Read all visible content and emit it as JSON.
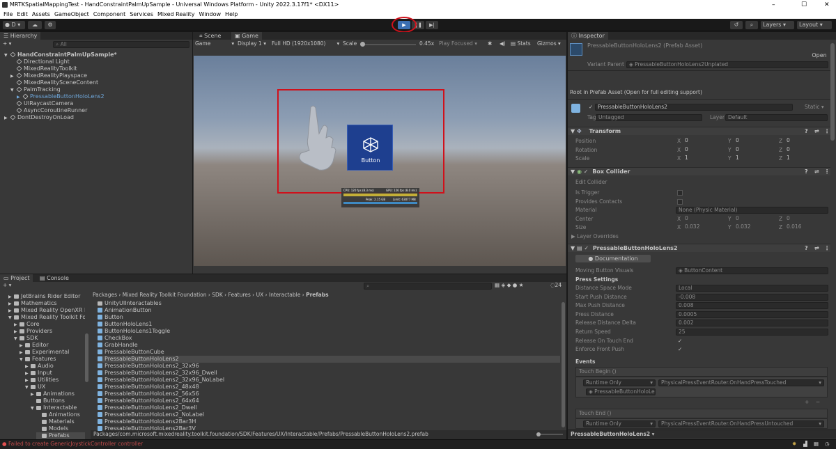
{
  "window": {
    "title": "MRTKSpatialMappingTest - HandConstraintPalmUpSample - Universal Windows Platform - Unity 2022.3.17f1* <DX11>",
    "minimize": "–",
    "maximize": "☐",
    "close": "✕"
  },
  "menu": [
    "File",
    "Edit",
    "Assets",
    "GameObject",
    "Component",
    "Services",
    "Mixed Reality",
    "Window",
    "Help"
  ],
  "toolbar": {
    "account": "D",
    "layers": "Layers",
    "layout": "Layout"
  },
  "hierarchy": {
    "tab": "Hierarchy",
    "search_placeholder": "All",
    "items": [
      {
        "label": "HandConstraintPalmUpSample*",
        "depth": 0,
        "bold": true,
        "arrow": "▼"
      },
      {
        "label": "Directional Light",
        "depth": 1,
        "arrow": ""
      },
      {
        "label": "MixedRealityToolkit",
        "depth": 1,
        "arrow": ""
      },
      {
        "label": "MixedRealityPlayspace",
        "depth": 1,
        "arrow": "▶"
      },
      {
        "label": "MixedRealitySceneContent",
        "depth": 1,
        "arrow": ""
      },
      {
        "label": "PalmTracking",
        "depth": 1,
        "arrow": "▼"
      },
      {
        "label": "PressableButtonHoloLens2",
        "depth": 2,
        "arrow": "▶",
        "blue": true
      },
      {
        "label": "UIRaycastCamera",
        "depth": 1,
        "arrow": ""
      },
      {
        "label": "AsyncCoroutineRunner",
        "depth": 1,
        "arrow": ""
      },
      {
        "label": "DontDestroyOnLoad",
        "depth": 0,
        "arrow": "▶"
      }
    ]
  },
  "game": {
    "tabs": [
      "Scene",
      "Game"
    ],
    "display_mode": "Game",
    "display": "Display 1",
    "resolution": "Full HD (1920x1080)",
    "scale_label": "Scale",
    "scale_value": "0.45x",
    "play_focused": "Play Focused",
    "stats": "Stats",
    "gizmos": "Gizmos",
    "button_label": "Button",
    "hud_cpu": "CPU: 120 fps (8.3 ms)",
    "hud_gpu": "GPU: 126 fps (8.0 ms)",
    "hud_mem": "Peak: 2.15 GB",
    "hud_limit": "Limit: 63077 MB"
  },
  "project": {
    "tabs": [
      "Project",
      "Console"
    ],
    "breadcrumb": [
      "Packages",
      "Mixed Reality Toolkit Foundation",
      "SDK",
      "Features",
      "UX",
      "Interactable",
      "Prefabs"
    ],
    "count": "24",
    "tree": [
      {
        "label": "JetBrains Rider Editor",
        "depth": 1,
        "arrow": "▶"
      },
      {
        "label": "Mathematics",
        "depth": 1,
        "arrow": "▶"
      },
      {
        "label": "Mixed Reality OpenXR Plu",
        "depth": 1,
        "arrow": "▶"
      },
      {
        "label": "Mixed Reality Toolkit Four",
        "depth": 1,
        "arrow": "▼"
      },
      {
        "label": "Core",
        "depth": 2,
        "arrow": "▶"
      },
      {
        "label": "Providers",
        "depth": 2,
        "arrow": "▶"
      },
      {
        "label": "SDK",
        "depth": 2,
        "arrow": "▼"
      },
      {
        "label": "Editor",
        "depth": 3,
        "arrow": "▶"
      },
      {
        "label": "Experimental",
        "depth": 3,
        "arrow": "▶"
      },
      {
        "label": "Features",
        "depth": 3,
        "arrow": "▼"
      },
      {
        "label": "Audio",
        "depth": 4,
        "arrow": "▶"
      },
      {
        "label": "Input",
        "depth": 4,
        "arrow": "▶"
      },
      {
        "label": "Utilities",
        "depth": 4,
        "arrow": "▶"
      },
      {
        "label": "UX",
        "depth": 4,
        "arrow": "▼"
      },
      {
        "label": "Animations",
        "depth": 5,
        "arrow": "▶"
      },
      {
        "label": "Buttons",
        "depth": 5,
        "arrow": ""
      },
      {
        "label": "Interactable",
        "depth": 5,
        "arrow": "▼"
      },
      {
        "label": "Animations",
        "depth": 6,
        "arrow": ""
      },
      {
        "label": "Materials",
        "depth": 6,
        "arrow": ""
      },
      {
        "label": "Models",
        "depth": 6,
        "arrow": ""
      },
      {
        "label": "Prefabs",
        "depth": 6,
        "arrow": "",
        "sel": true
      }
    ],
    "files": [
      {
        "label": "UnityUIInteractables",
        "type": "folder"
      },
      {
        "label": "AnimationButton",
        "type": "prefab"
      },
      {
        "label": "Button",
        "type": "prefab"
      },
      {
        "label": "ButtonHoloLens1",
        "type": "prefab"
      },
      {
        "label": "ButtonHoloLens1Toggle",
        "type": "prefab"
      },
      {
        "label": "CheckBox",
        "type": "prefab"
      },
      {
        "label": "GrabHandle",
        "type": "prefab"
      },
      {
        "label": "PressableButtonCube",
        "type": "prefab"
      },
      {
        "label": "PressableButtonHoloLens2",
        "type": "prefab",
        "sel": true
      },
      {
        "label": "PressableButtonHoloLens2_32x96",
        "type": "prefab"
      },
      {
        "label": "PressableButtonHoloLens2_32x96_Dwell",
        "type": "prefab"
      },
      {
        "label": "PressableButtonHoloLens2_32x96_NoLabel",
        "type": "prefab"
      },
      {
        "label": "PressableButtonHoloLens2_48x48",
        "type": "prefab"
      },
      {
        "label": "PressableButtonHoloLens2_56x56",
        "type": "prefab"
      },
      {
        "label": "PressableButtonHoloLens2_64x64",
        "type": "prefab"
      },
      {
        "label": "PressableButtonHoloLens2_Dwell",
        "type": "prefab"
      },
      {
        "label": "PressableButtonHoloLens2_NoLabel",
        "type": "prefab"
      },
      {
        "label": "PressableButtonHoloLens2Bar3H",
        "type": "prefab"
      },
      {
        "label": "PressableButtonHoloLens2Bar3V",
        "type": "prefab"
      }
    ],
    "path": "Packages/com.microsoft.mixedreality.toolkit.foundation/SDK/Features/UX/Interactable/Prefabs/PressableButtonHoloLens2.prefab"
  },
  "inspector": {
    "tab": "Inspector",
    "asset_title": "PressableButtonHoloLens2 (Prefab Asset)",
    "open": "Open",
    "variant_parent_label": "Variant Parent",
    "variant_parent": "PressableButtonHoloLens2Unplated",
    "root_note": "Root in Prefab Asset (Open for full editing support)",
    "object_name": "PressableButtonHoloLens2",
    "static": "Static",
    "tag_label": "Tag",
    "tag": "Untagged",
    "layer_label": "Layer",
    "layer": "Default",
    "transform": {
      "title": "Transform",
      "rows": [
        {
          "label": "Position",
          "x": "0",
          "y": "0",
          "z": "0"
        },
        {
          "label": "Rotation",
          "x": "0",
          "y": "0",
          "z": "0"
        },
        {
          "label": "Scale",
          "x": "1",
          "y": "1",
          "z": "1"
        }
      ]
    },
    "box_collider": {
      "title": "Box Collider",
      "edit": "Edit Collider",
      "is_trigger": "Is Trigger",
      "provides_contacts": "Provides Contacts",
      "material_label": "Material",
      "material": "None (Physic Material)",
      "center_label": "Center",
      "center": {
        "x": "0",
        "y": "0",
        "z": "0"
      },
      "size_label": "Size",
      "size": {
        "x": "0.032",
        "y": "0.032",
        "z": "0.016"
      },
      "layer_overrides": "Layer Overrides"
    },
    "script": {
      "title": "PressableButtonHoloLens2",
      "doc": "Documentation",
      "moving_label": "Moving Button Visuals",
      "moving": "ButtonContent",
      "press_settings": "Press Settings",
      "rows": [
        {
          "label": "Distance Space Mode",
          "value": "Local"
        },
        {
          "label": "Start Push Distance",
          "value": "-0.008"
        },
        {
          "label": "Max Push Distance",
          "value": "0.008"
        },
        {
          "label": "Press Distance",
          "value": "0.0005"
        },
        {
          "label": "Release Distance Delta",
          "value": "0.002"
        },
        {
          "label": "Return Speed",
          "value": "25"
        }
      ],
      "release_on_touch_end": "Release On Touch End",
      "enforce_front_push": "Enforce Front Push",
      "events": "Events",
      "touch_begin": "Touch Begin ()",
      "runtime": "Runtime Only",
      "touch_begin_fn": "PhysicalPressEventRouter.OnHandPressTouched",
      "touch_begin_obj": "PressableButtonHoloLe",
      "touch_end": "Touch End ()",
      "touch_end_fn": "PhysicalPressEventRouter.OnHandPressUntouched"
    },
    "footer": "PressableButtonHoloLens2"
  },
  "status": {
    "error": "Failed to create GenericJoystickController controller"
  }
}
